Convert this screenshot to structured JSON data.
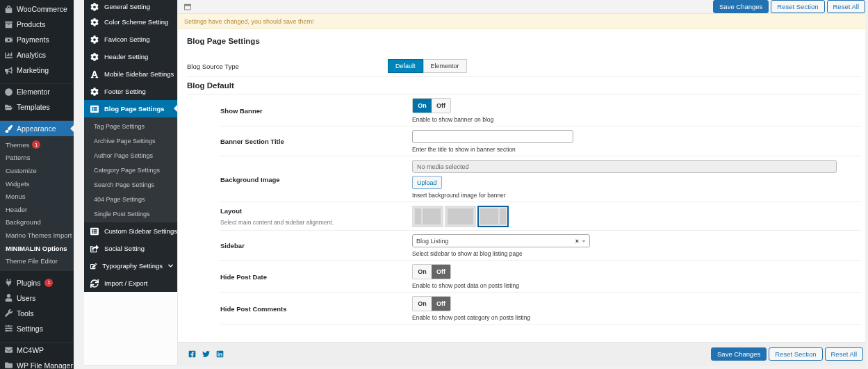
{
  "admin_menu": [
    {
      "label": "WooCommerce",
      "selected": false
    },
    {
      "label": "Products",
      "selected": false
    },
    {
      "label": "Payments",
      "selected": false
    },
    {
      "label": "Analytics",
      "selected": false
    },
    {
      "label": "Marketing",
      "selected": false,
      "gap_after": true
    },
    {
      "label": "Elementor",
      "selected": false
    },
    {
      "label": "Templates",
      "selected": false,
      "gap_after": true
    },
    {
      "label": "Appearance",
      "selected": true,
      "children": [
        {
          "label": "Themes",
          "badge": "1",
          "selected": false
        },
        {
          "label": "Patterns",
          "selected": false
        },
        {
          "label": "Customize",
          "selected": false
        },
        {
          "label": "Widgets",
          "selected": false
        },
        {
          "label": "Menus",
          "selected": false
        },
        {
          "label": "Header",
          "selected": false
        },
        {
          "label": "Background",
          "selected": false
        },
        {
          "label": "Marino Themes Import",
          "selected": false
        },
        {
          "label": "MINIMALIN Options",
          "selected": true
        },
        {
          "label": "Theme File Editor",
          "selected": false
        }
      ]
    },
    {
      "label": "Plugins",
      "badge": "1",
      "selected": false
    },
    {
      "label": "Users",
      "selected": false
    },
    {
      "label": "Tools",
      "selected": false
    },
    {
      "label": "Settings",
      "selected": false,
      "gap_after": true
    },
    {
      "label": "MC4WP",
      "selected": false
    },
    {
      "label": "WP File Manager",
      "selected": false
    }
  ],
  "options_nav": [
    {
      "label": "General Setting",
      "kind": "link",
      "selected": false
    },
    {
      "label": "Color Scheme Setting",
      "kind": "link",
      "selected": false
    },
    {
      "label": "Favicon Setting",
      "kind": "link",
      "selected": false
    },
    {
      "label": "Header Setting",
      "kind": "link",
      "selected": false
    },
    {
      "label": "Mobile Sidebar Settings",
      "kind": "link",
      "selected": false
    },
    {
      "label": "Footer Setting",
      "kind": "link",
      "selected": false
    },
    {
      "label": "Blog Page Settings",
      "kind": "group",
      "expanded": true,
      "selected": true,
      "children": [
        {
          "label": "Tag Page Settings",
          "selected": false
        },
        {
          "label": "Archive Page Settings",
          "selected": false
        },
        {
          "label": "Author Page Settings",
          "selected": false
        },
        {
          "label": "Category Page Settings",
          "selected": false
        },
        {
          "label": "Search Page Settings",
          "selected": false
        },
        {
          "label": "404 Page Settings",
          "selected": false
        },
        {
          "label": "Single Post Settings",
          "selected": false
        }
      ]
    },
    {
      "label": "Custom Sidebar Settings",
      "kind": "link",
      "selected": false
    },
    {
      "label": "Social Setting",
      "kind": "link",
      "selected": false
    },
    {
      "label": "Typography Settings",
      "kind": "group",
      "expanded": false,
      "selected": false
    },
    {
      "label": "Import / Export",
      "kind": "link",
      "selected": false
    }
  ],
  "top_buttons": [
    {
      "label": "Save Changes",
      "kind": "primary"
    },
    {
      "label": "Reset Section",
      "kind": "secondary"
    },
    {
      "label": "Reset All",
      "kind": "secondary"
    }
  ],
  "notice": "Settings have changed, you should save them!",
  "page_title": "Blog Page Settings",
  "source_type": {
    "label": "Blog Source Type",
    "options": [
      {
        "label": "Default",
        "selected": true
      },
      {
        "label": "Elementor",
        "selected": false
      }
    ]
  },
  "section_title": "Blog Default",
  "fields": [
    {
      "kind": "toggle",
      "label": "Show Banner",
      "on": true,
      "on_label": "On",
      "off_label": "Off",
      "help": "Enable to show banner on blog"
    },
    {
      "kind": "text",
      "label": "Banner Section Title",
      "help": "Enter the title to show in banner section"
    },
    {
      "kind": "media",
      "label": "Background Image",
      "placeholder": "No media selected",
      "button": "Upload",
      "help": "Insert background image for banner"
    },
    {
      "kind": "layout",
      "label": "Layout",
      "description": "Select main content and sidebar alignment.",
      "layouts": [
        {
          "kind": "left-sidebar",
          "selected": false
        },
        {
          "kind": "full-width",
          "selected": false
        },
        {
          "kind": "right-sidebar",
          "selected": true
        }
      ]
    },
    {
      "kind": "select",
      "label": "Sidebar",
      "value": "Blog Listing",
      "clear": "×",
      "help": "Select sidebar to show at blog listing page"
    },
    {
      "kind": "toggle",
      "label": "Hide Post Date",
      "on": false,
      "on_label": "On",
      "off_label": "Off",
      "help": "Enable to show post data on posts listing"
    },
    {
      "kind": "toggle",
      "label": "Hide Post Comments",
      "on": false,
      "on_label": "On",
      "off_label": "Off",
      "help": "Enable to show post category on posts listing"
    }
  ],
  "footer_buttons": [
    {
      "label": "Save Changes",
      "kind": "primary"
    },
    {
      "label": "Reset Section",
      "kind": "secondary"
    },
    {
      "label": "Reset All",
      "kind": "secondary"
    }
  ]
}
